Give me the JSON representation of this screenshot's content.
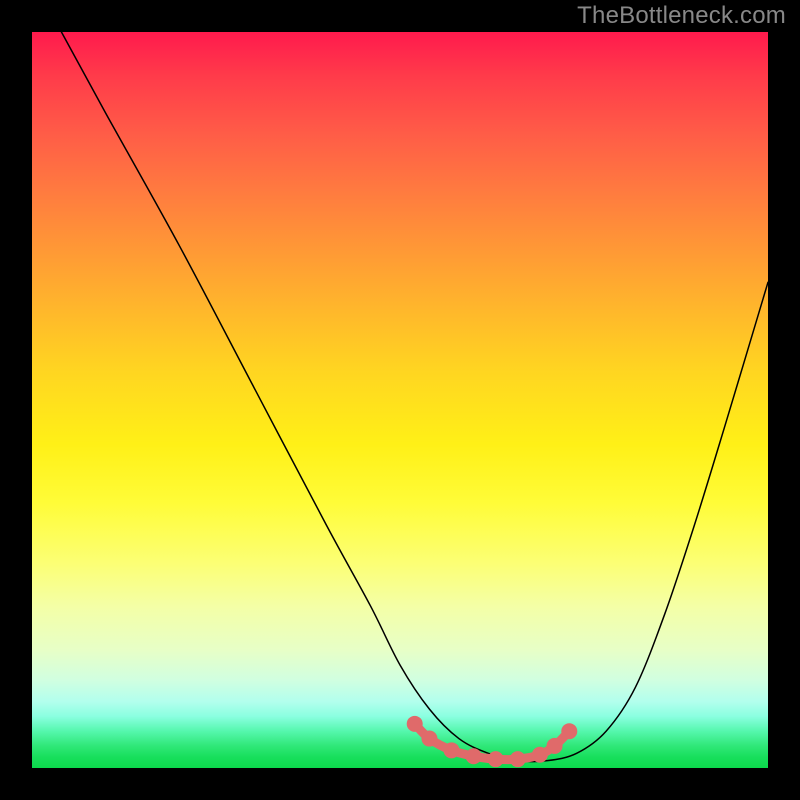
{
  "watermark": "TheBottleneck.com",
  "chart_data": {
    "type": "line",
    "title": "",
    "xlabel": "",
    "ylabel": "",
    "xlim": [
      0,
      100
    ],
    "ylim": [
      0,
      100
    ],
    "grid": false,
    "notes": "Axes unlabeled. Background is a vertical rainbow gradient (red at top → green at bottom). Main thin black curve descends from upper-left to a flat minimum near the bottom-center then rises toward the right edge. A short salmon/pink segment with dots sits along the flat minimum region.",
    "series": [
      {
        "name": "curve",
        "color": "#000000",
        "stroke_width": 1.5,
        "x": [
          4,
          10,
          20,
          30,
          40,
          46,
          50,
          54,
          58,
          62,
          66,
          70,
          74,
          78,
          82,
          86,
          90,
          94,
          100
        ],
        "y": [
          100,
          89,
          71,
          52,
          33,
          22,
          14,
          8,
          4,
          2,
          1,
          1,
          2,
          5,
          11,
          21,
          33,
          46,
          66
        ]
      },
      {
        "name": "optimal-band",
        "color": "#e06a6a",
        "stroke_width": 9,
        "marker": "circle",
        "marker_radius": 8,
        "x": [
          52,
          54,
          57,
          60,
          63,
          66,
          69,
          71,
          73
        ],
        "y": [
          6,
          4,
          2.4,
          1.6,
          1.2,
          1.2,
          1.8,
          3,
          5
        ]
      }
    ]
  }
}
